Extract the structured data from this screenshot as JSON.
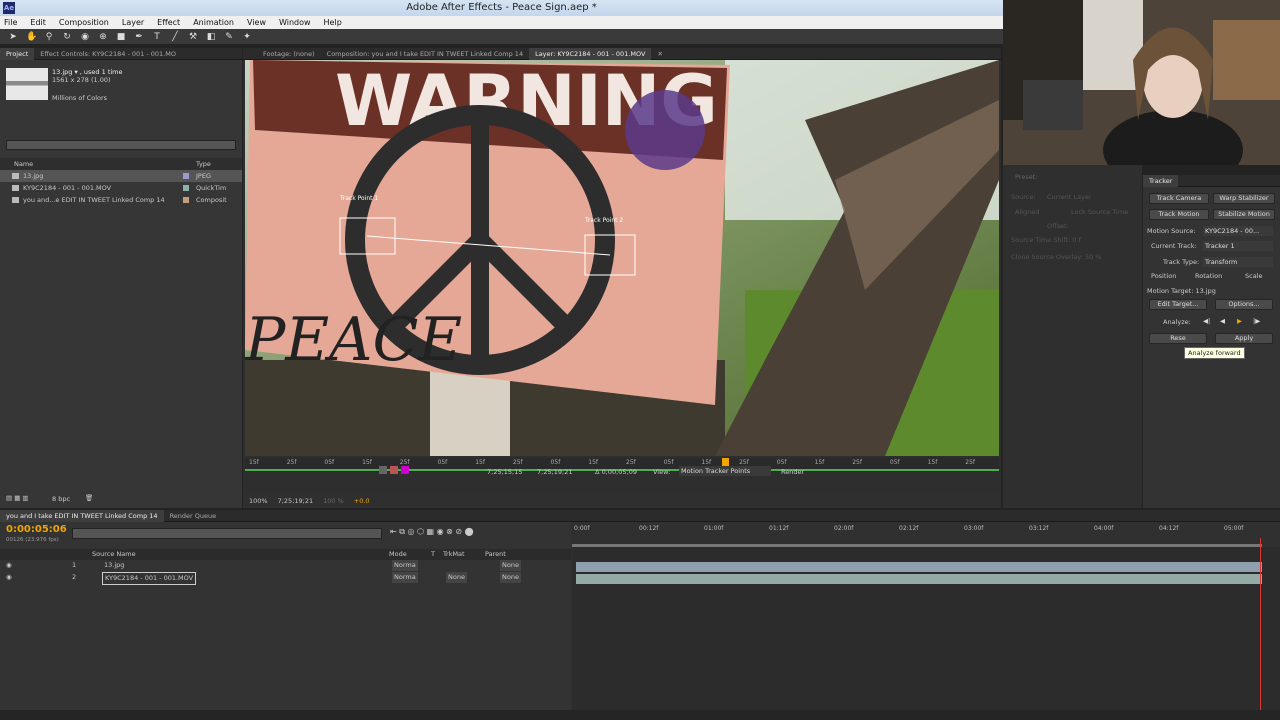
{
  "window": {
    "title": "Adobe After Effects - Peace Sign.aep *",
    "app_icon": "Ae"
  },
  "menu": [
    "File",
    "Edit",
    "Composition",
    "Layer",
    "Effect",
    "Animation",
    "View",
    "Window",
    "Help"
  ],
  "project_panel": {
    "tabs": [
      "Project",
      "Effect Controls: KY9C2184 - 001 - 001.MO"
    ],
    "selected_info": {
      "name": "13.jpg ▾ , used 1 time",
      "dims": "1561 x 278 (1.00)",
      "colors": "Millions of Colors"
    },
    "columns": {
      "name": "Name",
      "type": "Type"
    },
    "items": [
      {
        "name": "13.jpg",
        "type": "JPEG",
        "swatch": "#9a9ad0"
      },
      {
        "name": "KY9C2184 - 001 - 001.MOV",
        "type": "QuickTim",
        "swatch": "#8fb0a8"
      },
      {
        "name": "you and...e EDIT IN TWEET Linked Comp 14",
        "type": "Composit",
        "swatch": "#c0a080"
      }
    ],
    "bpc": "8 bpc"
  },
  "viewer": {
    "tabs": [
      "Footage: (none)",
      "Composition: you and I take EDIT IN TWEET Linked Comp 14",
      "Layer: KY9C2184 - 001 - 001.MOV"
    ],
    "sign_text": "WARNING",
    "track_points": [
      "Track Point 1",
      "Track Point 2"
    ],
    "ruler_ticks": [
      "15f",
      "25f",
      "05f",
      "15f",
      "25f",
      "05f",
      "15f",
      "25f",
      "05f",
      "15f",
      "25f",
      "05f",
      "15f",
      "25f",
      "05f",
      "15f",
      "25f",
      "05f",
      "15f",
      "25f"
    ],
    "controls": {
      "zoom": "100%",
      "timecode": "7;25;19;21",
      "opacity": "100 %",
      "in": "7;25;15;15",
      "out": "7;25;19;21",
      "duration": "Δ 0;00;05;09",
      "view_label": "View:",
      "view_value": "Motion Tracker Points",
      "render": "Render",
      "exposure": "+0.0"
    }
  },
  "effects_panel": {
    "preset": "Preset:",
    "source": "Source:",
    "source_val": "Current Layer",
    "aligned": "Aligned",
    "lock_source": "Lock Source Time",
    "offset": "Offset:",
    "source_time_shift": "Source Time Shift: 0 f",
    "clone_overlay": "Clone Source Overlay: 50 %"
  },
  "tracker": {
    "tab": "Tracker",
    "track_camera": "Track Camera",
    "warp_stabilizer": "Warp Stabilizer",
    "track_motion": "Track Motion",
    "stabilize_motion": "Stabilize Motion",
    "motion_source_label": "Motion Source:",
    "motion_source": "KY9C2184 - 00...",
    "current_track_label": "Current Track:",
    "current_track": "Tracker 1",
    "track_type_label": "Track Type:",
    "track_type": "Transform",
    "position": "Position",
    "rotation": "Rotation",
    "scale": "Scale",
    "motion_target": "Motion Target: 13.jpg",
    "edit_target": "Edit Target...",
    "options": "Options...",
    "analyze": "Analyze:",
    "reset": "Rese",
    "apply": "Apply",
    "tooltip": "Analyze forward"
  },
  "timeline": {
    "tabs": [
      "you and I take EDIT IN TWEET Linked Comp 14",
      "Render Queue"
    ],
    "timecode": "0:00:05:06",
    "fps": "00126 (23.976 fps)",
    "columns": {
      "source_name": "Source Name",
      "mode": "Mode",
      "t": "T",
      "trkmat": "TrkMat",
      "parent": "Parent"
    },
    "layers": [
      {
        "num": "1",
        "name": "13.jpg",
        "mode": "Norma",
        "trkmat": "",
        "parent": "None"
      },
      {
        "num": "2",
        "name": "KY9C2184 - 001 - 001.MOV",
        "mode": "Norma",
        "trkmat": "None",
        "parent": "None"
      }
    ],
    "ruler": [
      "0:00f",
      "00:12f",
      "01:00f",
      "01:12f",
      "02:00f",
      "02:12f",
      "03:00f",
      "03:12f",
      "04:00f",
      "04:12f",
      "05:00f"
    ]
  },
  "colors": {
    "accent": "#f0a500",
    "panel": "#363636",
    "bar1": "#8e9fae",
    "bar2": "#93aaa5"
  }
}
